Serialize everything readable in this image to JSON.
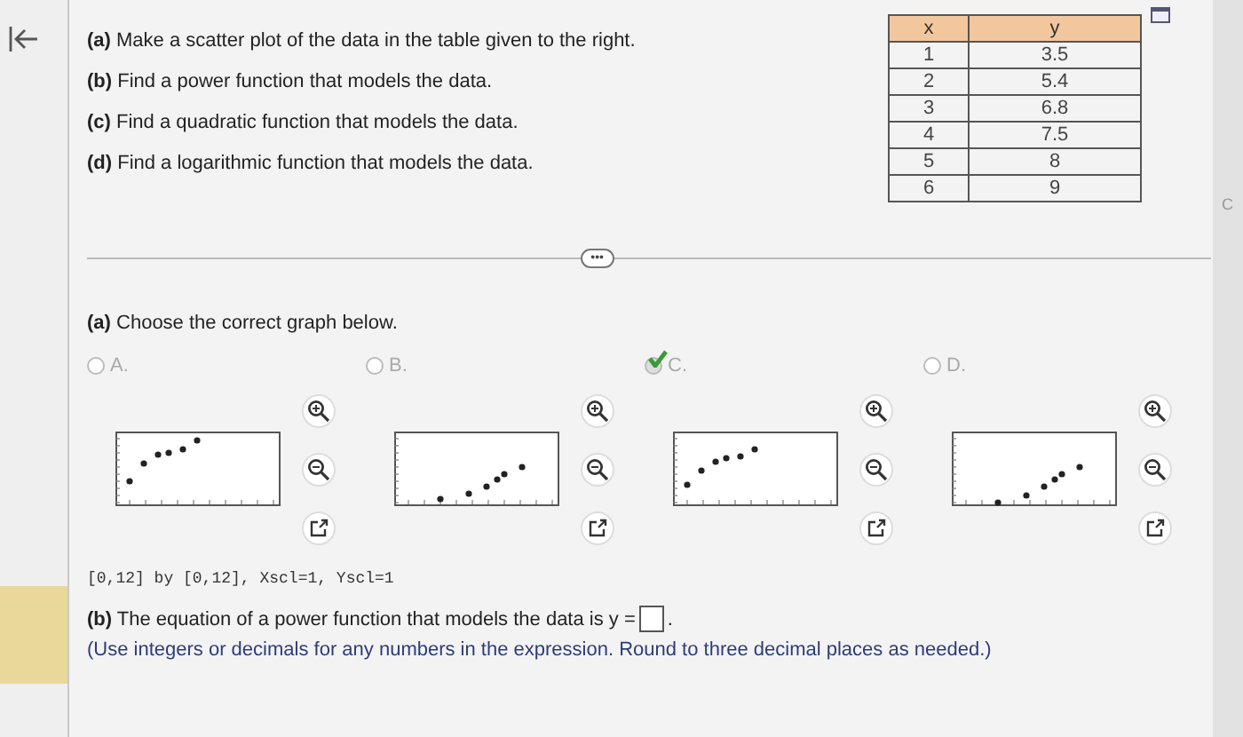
{
  "questions": [
    "**(a)** Make a scatter plot of the data in the table given to the right.",
    "**(b)** Find a power function that models the data.",
    "**(c)** Find a quadratic function that models the data.",
    "**(d)** Find a logarithmic function that models the data."
  ],
  "table": {
    "columns": [
      "x",
      "y"
    ],
    "rows": [
      [
        "1",
        "3.5"
      ],
      [
        "2",
        "5.4"
      ],
      [
        "3",
        "6.8"
      ],
      [
        "4",
        "7.5"
      ],
      [
        "5",
        "8"
      ],
      [
        "6",
        "9"
      ]
    ]
  },
  "more_button": "•••",
  "part_a": {
    "prompt": "**(a)** Choose the correct graph below.",
    "options": [
      {
        "label": "A.",
        "selected": false
      },
      {
        "label": "B.",
        "selected": false
      },
      {
        "label": "C.",
        "selected": true
      },
      {
        "label": "D.",
        "selected": false
      }
    ]
  },
  "window_note": "[0,12] by [0,12], Xscl=1, Yscl=1",
  "part_b": {
    "prompt": "**(b)** The equation of a power function that models the data is y =",
    "suffix": ".",
    "hint": "(Use integers or decimals for any numbers in the expression. Round to three decimal places as needed.)"
  },
  "edge_text": "C"
}
